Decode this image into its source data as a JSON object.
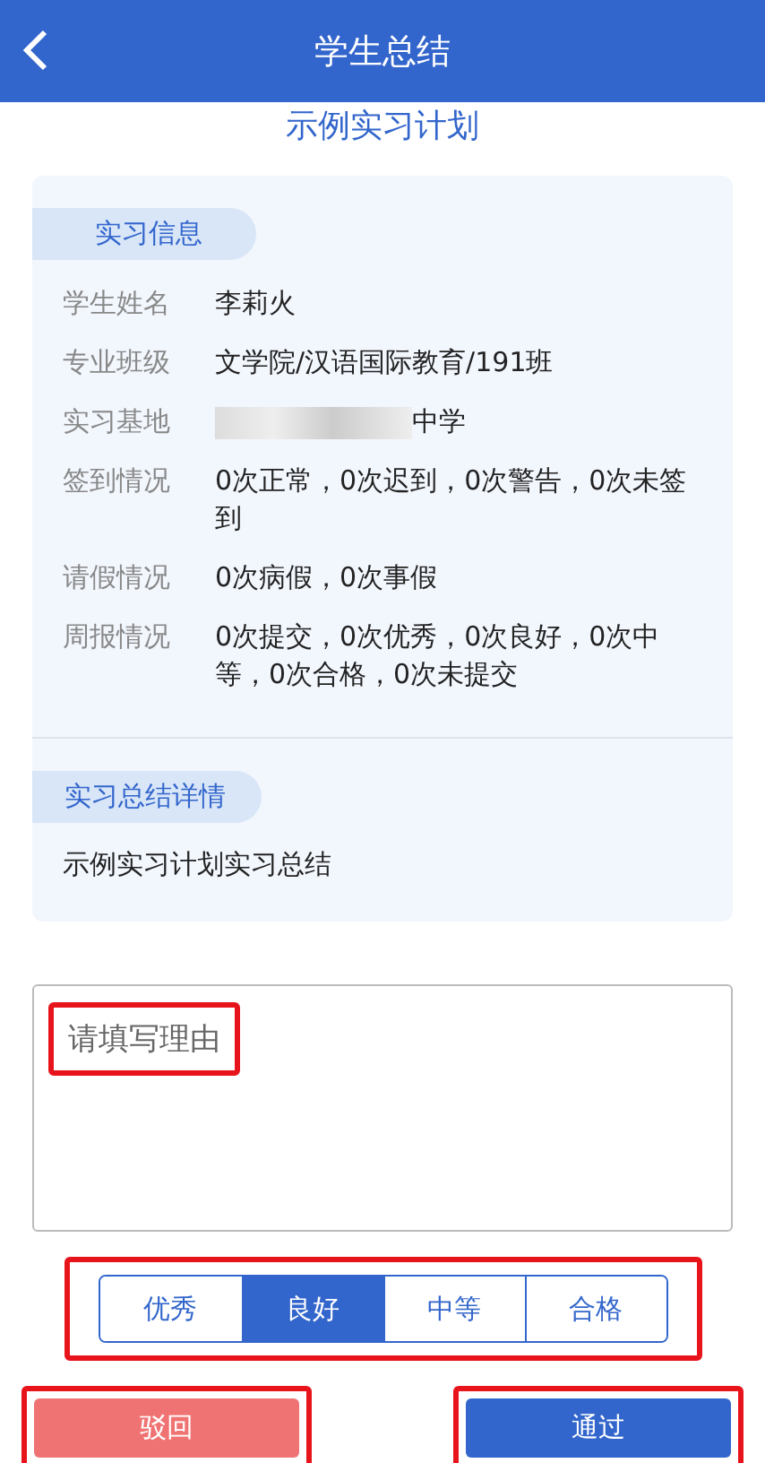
{
  "header": {
    "title": "学生总结"
  },
  "plan_title": "示例实习计划",
  "info": {
    "section_label": "实习信息",
    "rows": [
      {
        "label": "学生姓名",
        "value": "李莉火",
        "redacted": false
      },
      {
        "label": "专业班级",
        "value": "文学院/汉语国际教育/191班",
        "redacted": false
      },
      {
        "label": "实习基地",
        "value": "中学",
        "redacted": true
      },
      {
        "label": "签到情况",
        "value": "0次正常，0次迟到，0次警告，0次未签到",
        "redacted": false
      },
      {
        "label": "请假情况",
        "value": "0次病假，0次事假",
        "redacted": false
      },
      {
        "label": "周报情况",
        "value": "0次提交，0次优秀，0次良好，0次中等，0次合格，0次未提交",
        "redacted": false
      }
    ]
  },
  "summary": {
    "section_label": "实习总结详情",
    "text": "示例实习计划实习总结"
  },
  "reason_field": {
    "placeholder": "请填写理由",
    "highlighted": true
  },
  "grades": {
    "highlighted": true,
    "options": [
      {
        "label": "优秀",
        "selected": false
      },
      {
        "label": "良好",
        "selected": true
      },
      {
        "label": "中等",
        "selected": false
      },
      {
        "label": "合格",
        "selected": false
      }
    ]
  },
  "actions": [
    {
      "kind": "reject",
      "label": "驳回",
      "highlighted": true
    },
    {
      "kind": "approve",
      "label": "通过",
      "highlighted": true
    }
  ]
}
